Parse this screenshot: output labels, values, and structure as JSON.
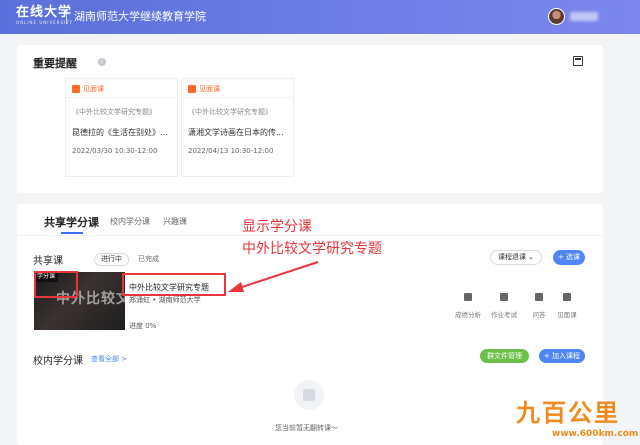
{
  "header": {
    "logo_main": "在线大学",
    "logo_sub": "ONLINE UNIVERSITY",
    "school_name": "湖南师范大学继续教育学院"
  },
  "reminders": {
    "title": "重要提醒",
    "info_glyph": "i",
    "items": [
      {
        "tag": "见面课",
        "course": "《中外比较文学研究专题》",
        "lesson": "昆德拉的《生活在别处》...",
        "time": "2022/03/30 10:30-12:00"
      },
      {
        "tag": "见面课",
        "course": "《中外比较文学研究专题》",
        "lesson": "潇湘文学诗画在日本的传...",
        "time": "2022/04/13 10:30-12:00"
      }
    ]
  },
  "tabs": [
    {
      "label": "共享学分课",
      "active": true
    },
    {
      "label": "校内学分课",
      "active": false
    },
    {
      "label": "兴趣课",
      "active": false
    }
  ],
  "shared": {
    "title": "共享课",
    "filter_active": "进行中",
    "filter_done": "已完成",
    "select_label": "课程退课 ⌄",
    "add_label": "+ 选课",
    "course": {
      "badge": "学分课",
      "thumb_text": "中外比较文学",
      "name": "中外比较文学研究专题",
      "teacher": "郑涌虹 • 湖南师范大学",
      "progress": "进度 0%",
      "actions": [
        "成绩分析",
        "作业考试",
        "问答",
        "见面课"
      ]
    }
  },
  "campus": {
    "title": "校内学分课",
    "view_all": "查看全部 >",
    "file_btn": "群文件管理",
    "join_btn": "+ 加入课程",
    "empty_text": "您当前暂无翻转课～"
  },
  "annotation": {
    "line1": "显示学分课",
    "line2": "中外比较文学研究专题"
  },
  "watermark": {
    "main": "九百公里",
    "sub": "www.600km.com"
  },
  "colors": {
    "header_start": "#5a6fd9",
    "accent_blue": "#4f86f7",
    "accent_orange": "#ff6a2b",
    "accent_green": "#6cc04a",
    "annotation_red": "#e8343a",
    "watermark_orange": "#f08a1c"
  }
}
